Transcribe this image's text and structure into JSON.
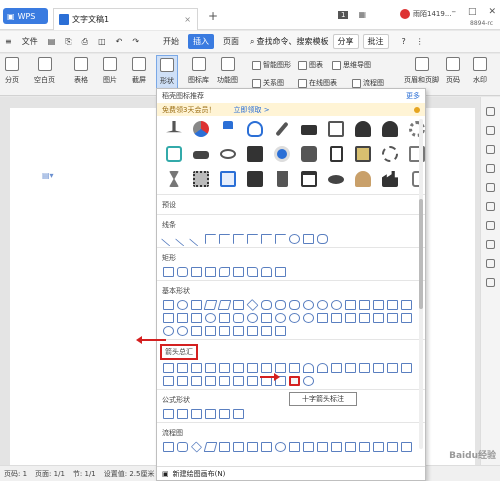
{
  "titlebar": {
    "wps_label": "WPS",
    "doc_tab": "文字文稿1",
    "badge": "1",
    "user": "雨陌1419...",
    "user_sub": "8894-rc"
  },
  "menubar": {
    "file": "文件",
    "items": [
      "开始",
      "插入",
      "页面"
    ],
    "search": "查找命令、搜索模板",
    "share": "分享",
    "comment": "批注"
  },
  "ribbon": {
    "items": [
      "分页",
      "空白页",
      "表格",
      "图片",
      "截屏",
      "形状",
      "图标库",
      "功能图"
    ],
    "small": [
      "智能图形",
      "图表",
      "思维导图",
      "关系图",
      "在线图表",
      "流程图"
    ],
    "right": [
      "页眉和页脚",
      "页码",
      "水印"
    ]
  },
  "dropdown": {
    "header": "稻壳图标推荐",
    "more": "更多",
    "vip_text": "免费领3天会员！",
    "vip_link": "立即领取 >",
    "sections": {
      "preset": "预设",
      "lines": "线条",
      "rect": "矩形",
      "basic": "基本形状",
      "arrows": "箭头总汇",
      "formula": "公式形状",
      "flow": "流程图"
    },
    "footer": "新建绘图画布(N)"
  },
  "tooltip": "十字箭头标注",
  "statusbar": {
    "page": "页码: 1",
    "pages": "页面: 1/1",
    "section": "节: 1/1",
    "setting": "设置值: 2.5厘米"
  },
  "watermark": "Baidu经验",
  "colors": {
    "accent": "#3a7be0",
    "highlight": "#d42020",
    "vip_bg": "#fff4d5"
  },
  "icons": [
    "pin-icon",
    "pie-chart-icon",
    "flag-icon",
    "bulb-icon",
    "pen-icon",
    "cake-icon",
    "notebook-icon",
    "users-icon",
    "user-icon",
    "gear-icon"
  ]
}
